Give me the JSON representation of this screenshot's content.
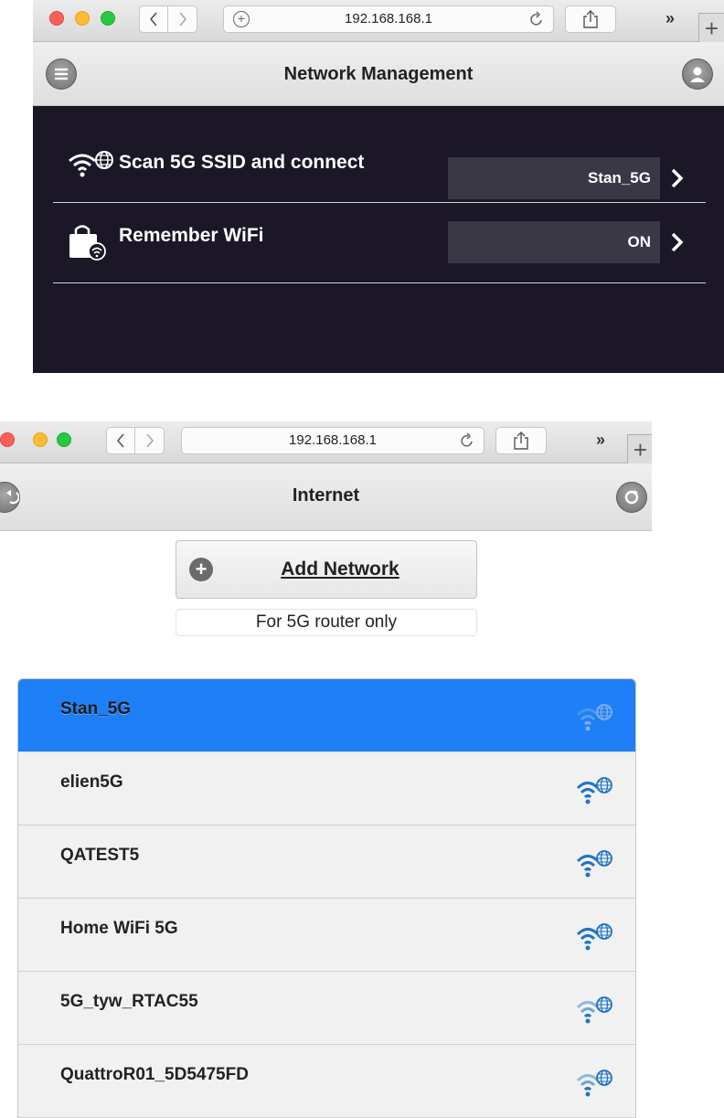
{
  "top_window": {
    "url": "192.168.168.1",
    "header_title": "Network Management",
    "rows": [
      {
        "label": "Scan 5G SSID and connect",
        "value": "Stan_5G",
        "icon": "wifi-globe-icon"
      },
      {
        "label": "Remember WiFi",
        "value": "ON",
        "icon": "bag-wifi-icon"
      }
    ],
    "header_left_icon": "menu-icon",
    "header_right_icon": "user-icon"
  },
  "bottom_window": {
    "url": "192.168.168.1",
    "header_title": "Internet",
    "header_left_icon": "back-icon",
    "header_right_icon": "refresh-icon",
    "add_network_label": "Add Network",
    "note": "For 5G router only",
    "networks": [
      {
        "ssid": "Stan_5G",
        "selected": true,
        "signal": "weak"
      },
      {
        "ssid": "elien5G",
        "selected": false,
        "signal": "strong"
      },
      {
        "ssid": "QATEST5",
        "selected": false,
        "signal": "strong"
      },
      {
        "ssid": "Home WiFi 5G",
        "selected": false,
        "signal": "strong"
      },
      {
        "ssid": "5G_tyw_RTAC55",
        "selected": false,
        "signal": "weak"
      },
      {
        "ssid": "QuattroR01_5D5475FD",
        "selected": false,
        "signal": "weak"
      }
    ]
  },
  "colors": {
    "dark_panel": "#1b1726",
    "value_box": "#3b3846",
    "selected_row": "#1e7ff6",
    "wifi_blue": "#1f74c7"
  }
}
